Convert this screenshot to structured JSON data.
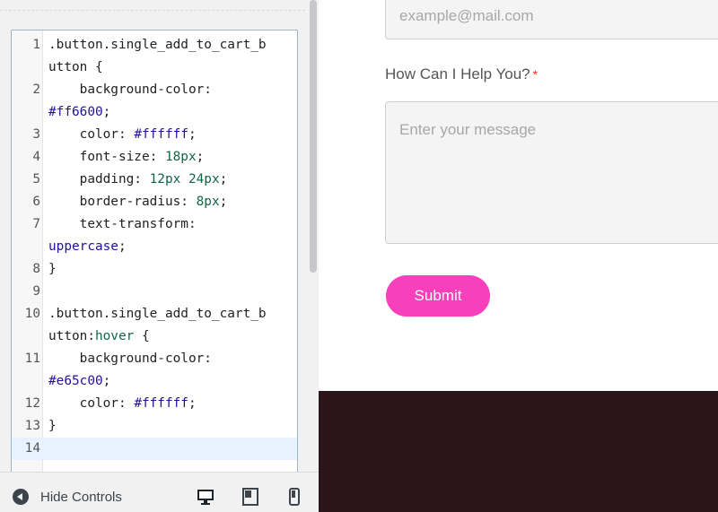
{
  "editor": {
    "lines": [
      {
        "n": "1",
        "segments": [
          {
            "t": ".button.single_add_to_cart_b",
            "c": ""
          }
        ]
      },
      {
        "n": "",
        "segments": [
          {
            "t": "utton {",
            "c": ""
          }
        ]
      },
      {
        "n": "2",
        "segments": [
          {
            "t": "    background-color:",
            "c": ""
          }
        ]
      },
      {
        "n": "",
        "segments": [
          {
            "t": "#ff6600",
            "c": "c-atom"
          },
          {
            "t": ";",
            "c": ""
          }
        ]
      },
      {
        "n": "3",
        "segments": [
          {
            "t": "    color: ",
            "c": ""
          },
          {
            "t": "#ffffff",
            "c": "c-atom"
          },
          {
            "t": ";",
            "c": ""
          }
        ]
      },
      {
        "n": "4",
        "segments": [
          {
            "t": "    font-size: ",
            "c": ""
          },
          {
            "t": "18px",
            "c": "c-num"
          },
          {
            "t": ";",
            "c": ""
          }
        ]
      },
      {
        "n": "5",
        "segments": [
          {
            "t": "    padding: ",
            "c": ""
          },
          {
            "t": "12px 24px",
            "c": "c-num"
          },
          {
            "t": ";",
            "c": ""
          }
        ]
      },
      {
        "n": "6",
        "segments": [
          {
            "t": "    border-radius: ",
            "c": ""
          },
          {
            "t": "8px",
            "c": "c-num"
          },
          {
            "t": ";",
            "c": ""
          }
        ]
      },
      {
        "n": "7",
        "segments": [
          {
            "t": "    text-transform:",
            "c": ""
          }
        ]
      },
      {
        "n": "",
        "segments": [
          {
            "t": "uppercase",
            "c": "c-key"
          },
          {
            "t": ";",
            "c": ""
          }
        ]
      },
      {
        "n": "8",
        "segments": [
          {
            "t": "}",
            "c": ""
          }
        ]
      },
      {
        "n": "9",
        "segments": [
          {
            "t": "",
            "c": ""
          }
        ]
      },
      {
        "n": "10",
        "segments": [
          {
            "t": ".button.single_add_to_cart_b",
            "c": ""
          }
        ]
      },
      {
        "n": "",
        "segments": [
          {
            "t": "utton:",
            "c": ""
          },
          {
            "t": "hover",
            "c": "c-num"
          },
          {
            "t": " {",
            "c": ""
          }
        ]
      },
      {
        "n": "11",
        "segments": [
          {
            "t": "    background-color:",
            "c": ""
          }
        ]
      },
      {
        "n": "",
        "segments": [
          {
            "t": "#e65c00",
            "c": "c-atom"
          },
          {
            "t": ";",
            "c": ""
          }
        ]
      },
      {
        "n": "12",
        "segments": [
          {
            "t": "    color: ",
            "c": ""
          },
          {
            "t": "#ffffff",
            "c": "c-atom"
          },
          {
            "t": ";",
            "c": ""
          }
        ]
      },
      {
        "n": "13",
        "segments": [
          {
            "t": "}",
            "c": ""
          }
        ]
      },
      {
        "n": "14",
        "segments": [
          {
            "t": "",
            "c": ""
          }
        ],
        "active": true
      }
    ]
  },
  "controls": {
    "hide_label": "Hide Controls",
    "hide_icon": "arrow-left-circle-icon",
    "devices": [
      "desktop-icon",
      "tablet-icon",
      "mobile-icon"
    ]
  },
  "form": {
    "email_placeholder": "example@mail.com",
    "message_label": "How Can I Help You?",
    "required_mark": "*",
    "message_placeholder": "Enter your message",
    "submit_label": "Submit"
  },
  "colors": {
    "submit_bg": "#f83fbc",
    "footer_bg": "#2c151a",
    "editor_border": "#9bb5cc"
  }
}
